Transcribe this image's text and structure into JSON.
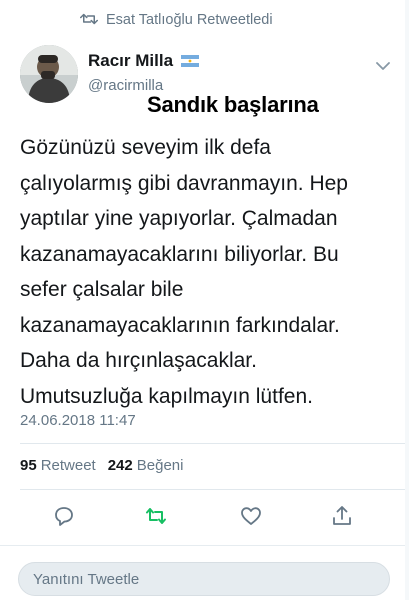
{
  "retweet_header": {
    "text": "Esat Tatlıoğlu Retweetledi",
    "icon": "retweet-icon"
  },
  "author": {
    "name": "Racır Milla",
    "handle": "@racirmilla",
    "flag": "argentina-flag"
  },
  "overlay_caption": "Sandık başlarına",
  "tweet": {
    "lines": [
      "Gözünüzü seveyim ilk defa",
      "çalıyolarmış gibi davranmayın. Hep",
      "yaptılar yine yapıyorlar. Çalmadan",
      "kazanamayacaklarını biliyorlar. Bu",
      "sefer çalsalar bile",
      "kazanamayacaklarının farkındalar.",
      "Daha da hırçınlaşacaklar.",
      "Umutsuzluğa kapılmayın lütfen."
    ],
    "timestamp": "24.06.2018 11:47"
  },
  "stats": {
    "retweets_count": "95",
    "retweets_label": "Retweet",
    "likes_count": "242",
    "likes_label": "Beğeni"
  },
  "actions": {
    "reply_icon": "reply-icon",
    "retweet_icon": "retweet-icon",
    "like_icon": "heart-icon",
    "share_icon": "share-icon"
  },
  "reply": {
    "placeholder": "Yanıtını Tweetle"
  },
  "colors": {
    "text_primary": "#14171a",
    "text_secondary": "#657786",
    "retweet_green": "#17bf63",
    "divider": "#e1e8ed"
  }
}
